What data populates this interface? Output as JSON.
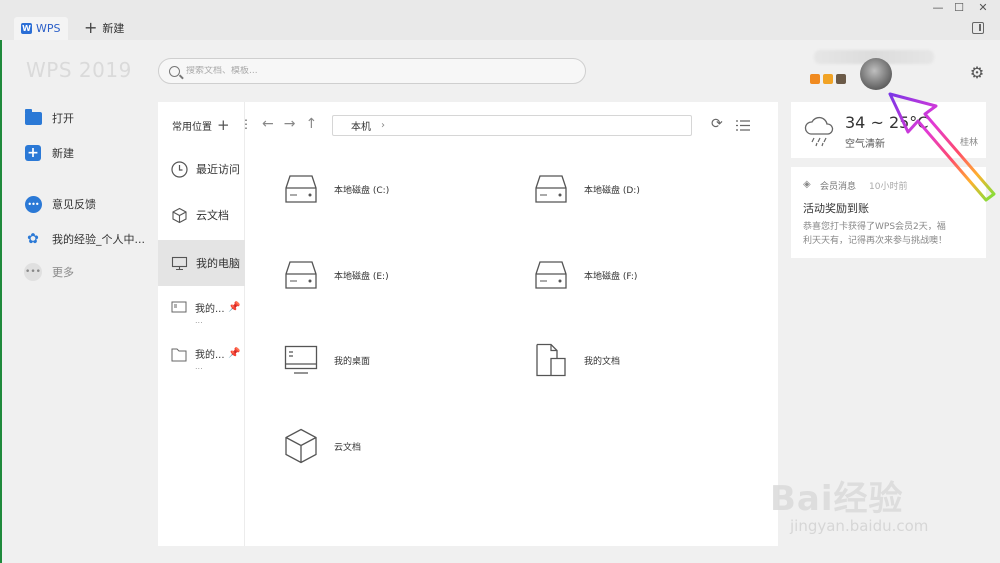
{
  "tabs": {
    "app_tab_label": "WPS",
    "new_tab_label": "新建"
  },
  "window_controls": {
    "minimize": "—",
    "maximize": "☐",
    "close": "✕"
  },
  "header": {
    "logo_text": "WPS 2019",
    "search_placeholder": "搜索文档、模板..."
  },
  "badges": [
    "#f08a1f",
    "#f1a325",
    "#6b5a48"
  ],
  "sidebar": {
    "items": [
      {
        "label": "打开"
      },
      {
        "label": "新建"
      },
      {
        "label": "意见反馈"
      },
      {
        "label": "我的经验_个人中..."
      },
      {
        "label": "更多"
      }
    ]
  },
  "locations": {
    "header": "常用位置",
    "items": [
      {
        "label": "最近访问"
      },
      {
        "label": "云文档"
      },
      {
        "label": "我的电脑"
      }
    ],
    "pinned": [
      {
        "title": "我的...",
        "sub": "..."
      },
      {
        "title": "我的...",
        "sub": "..."
      }
    ]
  },
  "nav": {
    "breadcrumb": "本机"
  },
  "drives": [
    {
      "label": "本地磁盘 (C:)"
    },
    {
      "label": "本地磁盘 (D:)"
    },
    {
      "label": "本地磁盘 (E:)"
    },
    {
      "label": "本地磁盘 (F:)"
    },
    {
      "label": "我的桌面"
    },
    {
      "label": "我的文档"
    },
    {
      "label": "云文档"
    }
  ],
  "weather": {
    "temp": "34 ~ 25°C",
    "desc": "空气清新",
    "city": "桂林"
  },
  "notice": {
    "category": "会员消息",
    "time": "10小时前",
    "title": "活动奖励到账",
    "body": "恭喜您打卡获得了WPS会员2天，福利天天有，记得再次来参与挑战噢！"
  },
  "watermark": {
    "brand": "Bai经验",
    "url": "jingyan.baidu.com"
  }
}
